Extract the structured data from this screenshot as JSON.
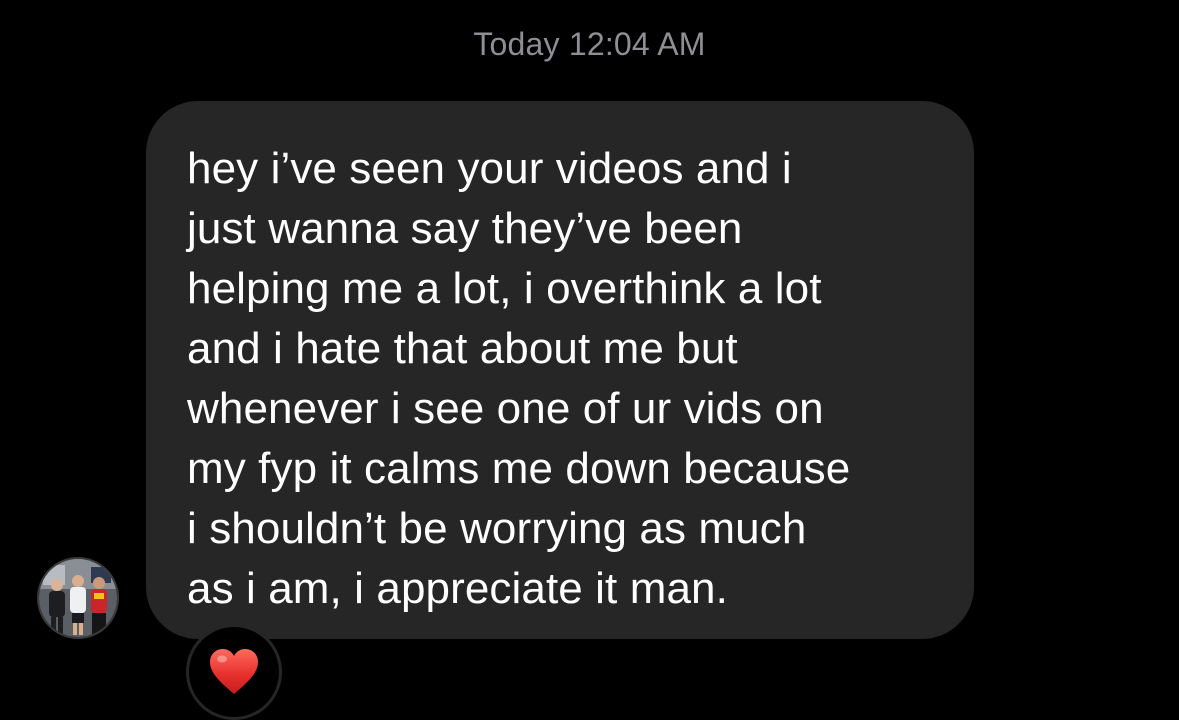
{
  "header": {
    "timestamp": "Today 12:04 AM"
  },
  "message": {
    "lines": [
      "hey i’ve seen your videos and i",
      "just wanna say they’ve been",
      "helping me a lot, i overthink a lot",
      "and i hate that about me but",
      "whenever i see one of ur vids on",
      "my fyp it calms me down because",
      "i shouldn’t be worrying as much",
      "as i am, i appreciate it man."
    ]
  },
  "sender": {
    "avatar_icon": "profile-photo-group"
  },
  "reaction": {
    "icon": "red-heart-icon",
    "color": "#e8322e"
  },
  "colors": {
    "background": "#000000",
    "bubble": "#262626",
    "timestamp": "#8e8e93",
    "text": "#ffffff"
  }
}
